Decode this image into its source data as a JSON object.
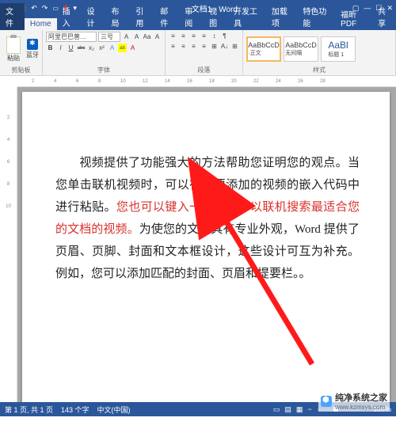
{
  "title_bar": {
    "doc_title": "文档1 - Word"
  },
  "tabs": [
    "文件",
    "Home",
    "插入",
    "设计",
    "布局",
    "引用",
    "邮件",
    "审阅",
    "视图",
    "开发工具",
    "加载项",
    "特色功能",
    "福昕PDF"
  ],
  "share_label": "共享",
  "ribbon": {
    "clipboard": {
      "paste": "粘贴",
      "bt": "蓝牙",
      "label": "剪贴板"
    },
    "font": {
      "family": "阿里巴巴普…",
      "size": "三号",
      "btns_row1": [
        "A",
        "A",
        "Aa",
        "",
        "A"
      ],
      "btns_row2": [
        "B",
        "I",
        "U",
        "abc",
        "x₂",
        "x²",
        "A",
        "ab",
        "A"
      ],
      "label": "字体"
    },
    "paragraph": {
      "row1": [
        "≡",
        "≡",
        "≡",
        "≡",
        "↕",
        "¶"
      ],
      "row2": [
        "≡",
        "≡",
        "≡",
        "≡",
        "⊞",
        "A↓",
        "⊞"
      ],
      "label": "段落"
    },
    "styles": {
      "items": [
        {
          "t": "AaBbCcD",
          "s": "·正文"
        },
        {
          "t": "AaBbCcD",
          "s": "无间隔"
        },
        {
          "t": "AaBl",
          "s": "标题 1"
        }
      ],
      "label": "样式"
    }
  },
  "document": {
    "p1a": "视频提供了功能强大的方法帮助您证明您的观点。当您单击联机视频时，可以在想要添加的视频的嵌入代码中进行粘贴。",
    "p1b": "您也可以键入一个关键字以联机搜索最适合您的文档的视频。",
    "p1c": "为使您的文档具有专业外观，Word 提供了页眉、页脚、封面和文本框设计，这些设计可互为补充。例如，您可以添加匹配的封面、页眉和提要栏。"
  },
  "status_bar": {
    "page": "第 1 页, 共 1 页",
    "words": "143 个字",
    "lang": "中文(中国)",
    "zoom": "100%"
  },
  "watermark": {
    "text": "纯净系统之家",
    "url": "www.kzmsys.com"
  }
}
